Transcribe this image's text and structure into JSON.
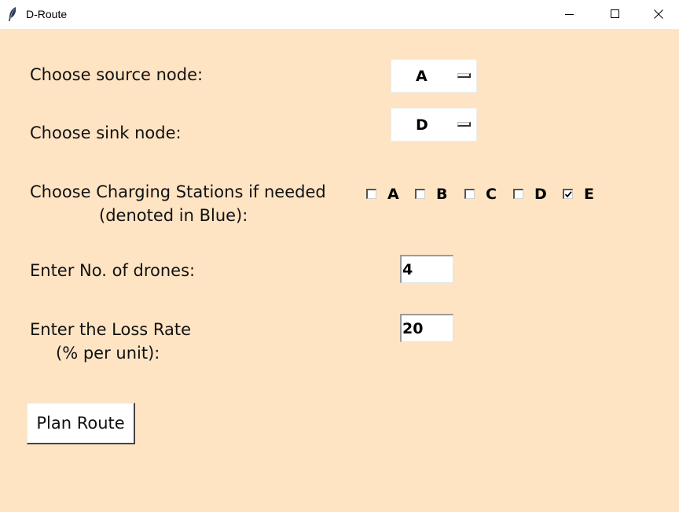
{
  "window": {
    "title": "D-Route",
    "controls": {
      "minimize": "minimize-icon",
      "maximize": "maximize-icon",
      "close": "close-icon"
    }
  },
  "colors": {
    "background": "#ffe4c4",
    "text": "#111111"
  },
  "form": {
    "source_label": "Choose source node:",
    "source_value": "A",
    "sink_label": "Choose sink node:",
    "sink_value": "D",
    "charging_label_line1": "Choose Charging Stations if needed",
    "charging_label_line2": "(denoted in Blue):",
    "charging_options": [
      {
        "label": "A",
        "checked": false
      },
      {
        "label": "B",
        "checked": false
      },
      {
        "label": "C",
        "checked": false
      },
      {
        "label": "D",
        "checked": false
      },
      {
        "label": "E",
        "checked": true
      }
    ],
    "drones_label": "Enter No. of drones:",
    "drones_value": "4",
    "loss_label_line1": "Enter the Loss Rate",
    "loss_label_line2": "(% per unit):",
    "loss_value": "20",
    "plan_button": "Plan Route"
  }
}
